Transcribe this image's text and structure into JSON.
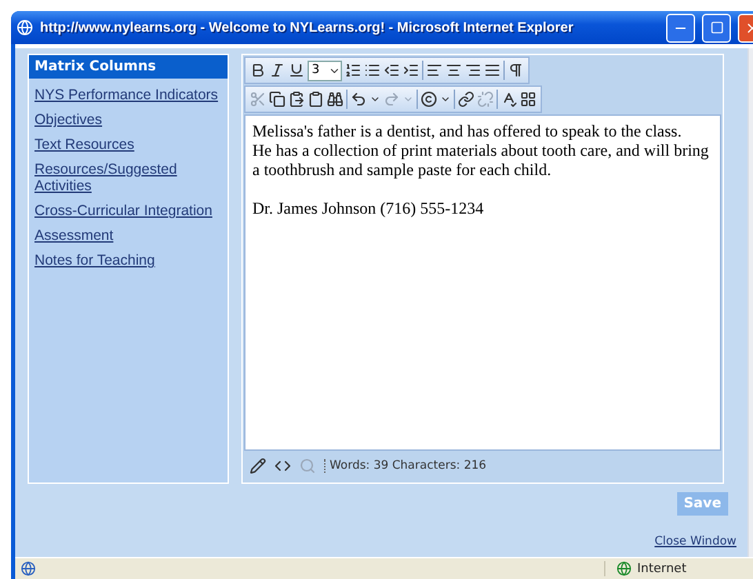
{
  "window": {
    "title": "http://www.nylearns.org - Welcome to NYLearns.org! - Microsoft Internet Explorer"
  },
  "sidebar": {
    "heading": "Matrix Columns",
    "items": [
      {
        "label": "NYS Performance Indicators"
      },
      {
        "label": "Objectives"
      },
      {
        "label": "Text Resources"
      },
      {
        "label": "Resources/Suggested Activities"
      },
      {
        "label": "Cross-Curricular Integration"
      },
      {
        "label": "Assessment"
      },
      {
        "label": "Notes for Teaching"
      }
    ]
  },
  "editor": {
    "font_size": "3",
    "paragraphs": [
      {
        "lines": [
          "Melissa's father is a dentist, and has offered to speak to the class.",
          "He has a collection of print materials about tooth care, and will bring",
          "a toothbrush and sample paste for each child."
        ]
      },
      {
        "lines": [
          "Dr. James Johnson (716) 555-1234"
        ]
      }
    ],
    "status": "Words: 39 Characters: 216"
  },
  "save_button": "Save",
  "close_link": "Close Window",
  "status_bar": {
    "zone": "Internet"
  }
}
